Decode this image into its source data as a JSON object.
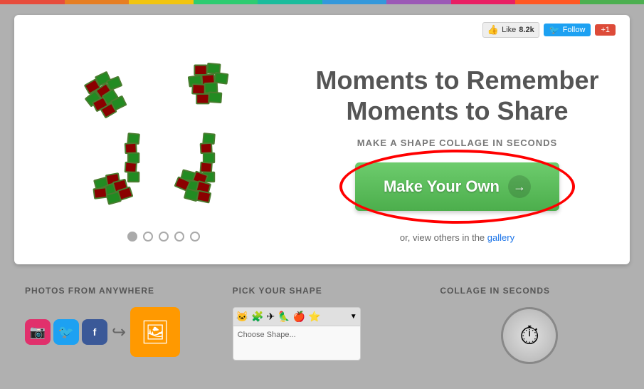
{
  "rainbow_colors": [
    "#e74c3c",
    "#e67e22",
    "#f1c40f",
    "#2ecc71",
    "#1abc9c",
    "#3498db",
    "#9b59b6",
    "#e91e63",
    "#ff5722",
    "#4caf50"
  ],
  "social": {
    "like_label": "Like",
    "like_count": "8.2k",
    "follow_label": "Follow",
    "gplus_label": "+1"
  },
  "hero": {
    "title_line1": "Moments to Remember",
    "title_line2": "Moments to Share",
    "subtitle": "MAKE A SHAPE COLLAGE IN SECONDS",
    "cta_label": "Make Your Own",
    "gallery_text": "or, view others in the",
    "gallery_link_text": "gallery"
  },
  "pagination": {
    "dots": [
      1,
      2,
      3,
      4,
      5
    ],
    "active": 1
  },
  "features": {
    "col1": {
      "title": "PHOTOS FROM ANYWHERE"
    },
    "col2": {
      "title": "PICK YOUR SHAPE"
    },
    "col3": {
      "title": "COLLAGE IN SECONDS"
    }
  }
}
